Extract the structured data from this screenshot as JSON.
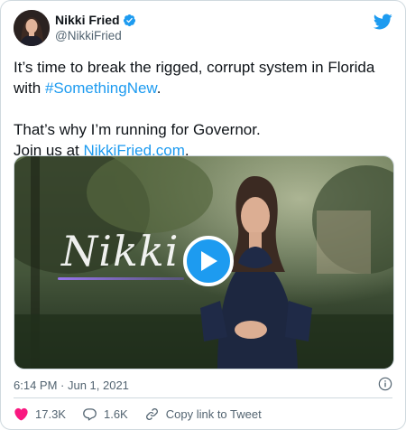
{
  "author": {
    "name": "Nikki Fried",
    "handle": "@NikkiFried",
    "avatar_icon": "profile-photo"
  },
  "tweet": {
    "line1": "It’s time to break the rigged, corrupt system in Florida",
    "line2_prefix": "with ",
    "hashtag": "#SomethingNew",
    "line2_suffix": ".",
    "line3": "That’s why I’m running for Governor.",
    "line4_prefix": "Join us at ",
    "url": "NikkiFried.com",
    "line4_suffix": "."
  },
  "media": {
    "watermark_text": "Nikki",
    "play_icon": "play-icon"
  },
  "meta": {
    "timestamp": "6:14 PM · Jun 1, 2021"
  },
  "actions": {
    "likes": "17.3K",
    "replies": "1.6K",
    "share_label": "Copy link to Tweet"
  },
  "colors": {
    "accent": "#1d9bf0",
    "like": "#f91880",
    "text": "#0f1419",
    "muted": "#536471"
  }
}
